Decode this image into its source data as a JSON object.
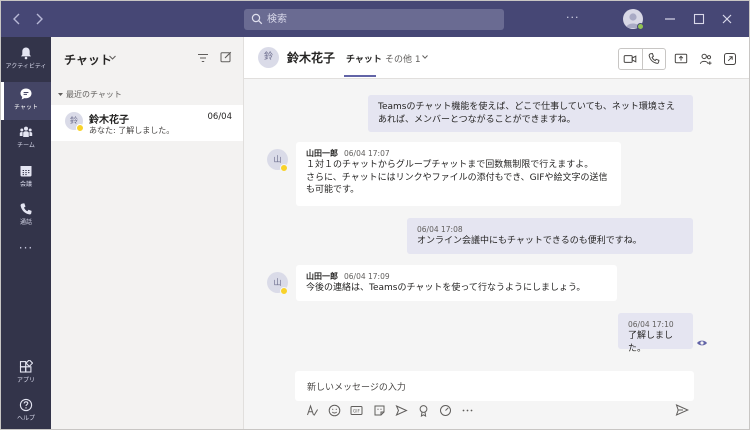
{
  "titlebar": {
    "back_icon": "chevron-left-icon",
    "forward_icon": "chevron-right-icon",
    "search_placeholder": "検索",
    "more_label": "···",
    "colors": {
      "bar": "#464775",
      "status": "#92c353"
    }
  },
  "rail": {
    "items": [
      {
        "label": "アクティビティ",
        "icon": "bell-icon"
      },
      {
        "label": "チャット",
        "icon": "chat-icon"
      },
      {
        "label": "チーム",
        "icon": "teams-icon"
      },
      {
        "label": "会議",
        "icon": "calendar-icon"
      },
      {
        "label": "通話",
        "icon": "phone-icon"
      }
    ],
    "more_label": "···",
    "bottom": [
      {
        "label": "アプリ",
        "icon": "apps-icon"
      },
      {
        "label": "ヘルプ",
        "icon": "help-icon"
      }
    ],
    "active": "チャット"
  },
  "chatlist": {
    "title": "チャット",
    "caret": "⌄",
    "section": "最近のチャット",
    "items": [
      {
        "avatar": "鈴",
        "name": "鈴木花子",
        "date": "06/04",
        "preview": "あなた: 了解しました。"
      }
    ]
  },
  "conversation": {
    "avatar": "鈴",
    "name": "鈴木花子",
    "tabs": [
      {
        "label": "チャット"
      },
      {
        "label": "その他 1"
      }
    ],
    "messages": [
      {
        "direction": "out",
        "time": "",
        "lines": [
          "Teamsのチャット機能を使えば、どこで仕事していても、ネット環境さえ",
          "あれば、メンバーとつながることができますね。"
        ]
      },
      {
        "direction": "in",
        "avatar": "山",
        "author": "山田一郎",
        "time": "06/04 17:07",
        "lines": [
          "１対１のチャットからグループチャットまで回数無制限で行えますよ。",
          "さらに、チャットにはリンクやファイルの添付もでき、GIFや絵文字の送信",
          "も可能です。"
        ]
      },
      {
        "direction": "out",
        "time": "06/04 17:08",
        "lines": [
          "オンライン会議中にもチャットできるのも便利ですね。"
        ]
      },
      {
        "direction": "in",
        "avatar": "山",
        "author": "山田一郎",
        "time": "06/04 17:09",
        "lines": [
          "今後の連絡は、Teamsのチャットを使って行なうようにしましょう。"
        ]
      },
      {
        "direction": "out",
        "time": "06/04 17:10",
        "lines": [
          "了解しました。"
        ]
      }
    ],
    "compose_placeholder": "新しいメッセージの入力",
    "colors": {
      "outgoing": "#e5e5f1",
      "accent": "#6264a7",
      "away": "#f8d22a"
    }
  }
}
